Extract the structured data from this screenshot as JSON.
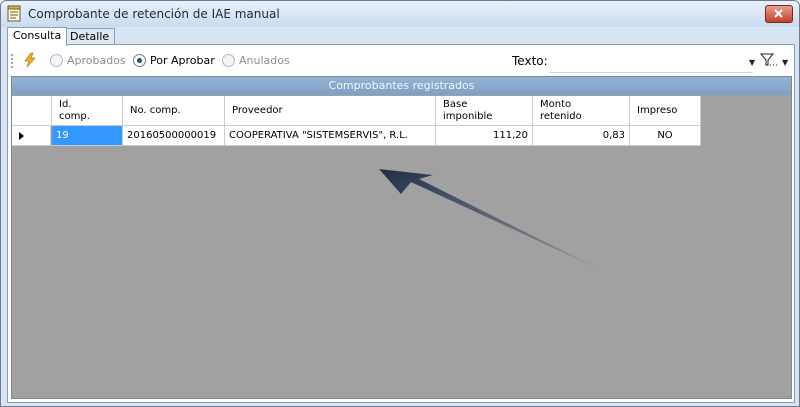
{
  "window": {
    "title": "Comprobante de retención de IAE manual"
  },
  "tabs": [
    {
      "label": "Consulta"
    },
    {
      "label": "Detalle"
    }
  ],
  "filters": {
    "options": [
      {
        "label": "Aprobados",
        "selected": false
      },
      {
        "label": "Por Aprobar",
        "selected": true
      },
      {
        "label": "Anulados",
        "selected": false
      }
    ],
    "search_label": "Texto:",
    "search_value": ""
  },
  "grid": {
    "caption": "Comprobantes registrados",
    "columns": [
      {
        "label": "Id.\ncomp."
      },
      {
        "label": "No. comp."
      },
      {
        "label": "Proveedor"
      },
      {
        "label": "Base\nimponible"
      },
      {
        "label": "Monto\nretenido"
      },
      {
        "label": "Impreso"
      }
    ],
    "rows": [
      {
        "id": "19",
        "numero": "20160500000019",
        "proveedor": "COOPERATIVA \"SISTEMSERVIS\", R.L.",
        "base": "111,20",
        "monto": "0,83",
        "impreso": "NO"
      }
    ]
  },
  "colors": {
    "selection": "#3399ff",
    "caption_bg": "#8aaad0",
    "empty_area": "#a1a1a1"
  }
}
